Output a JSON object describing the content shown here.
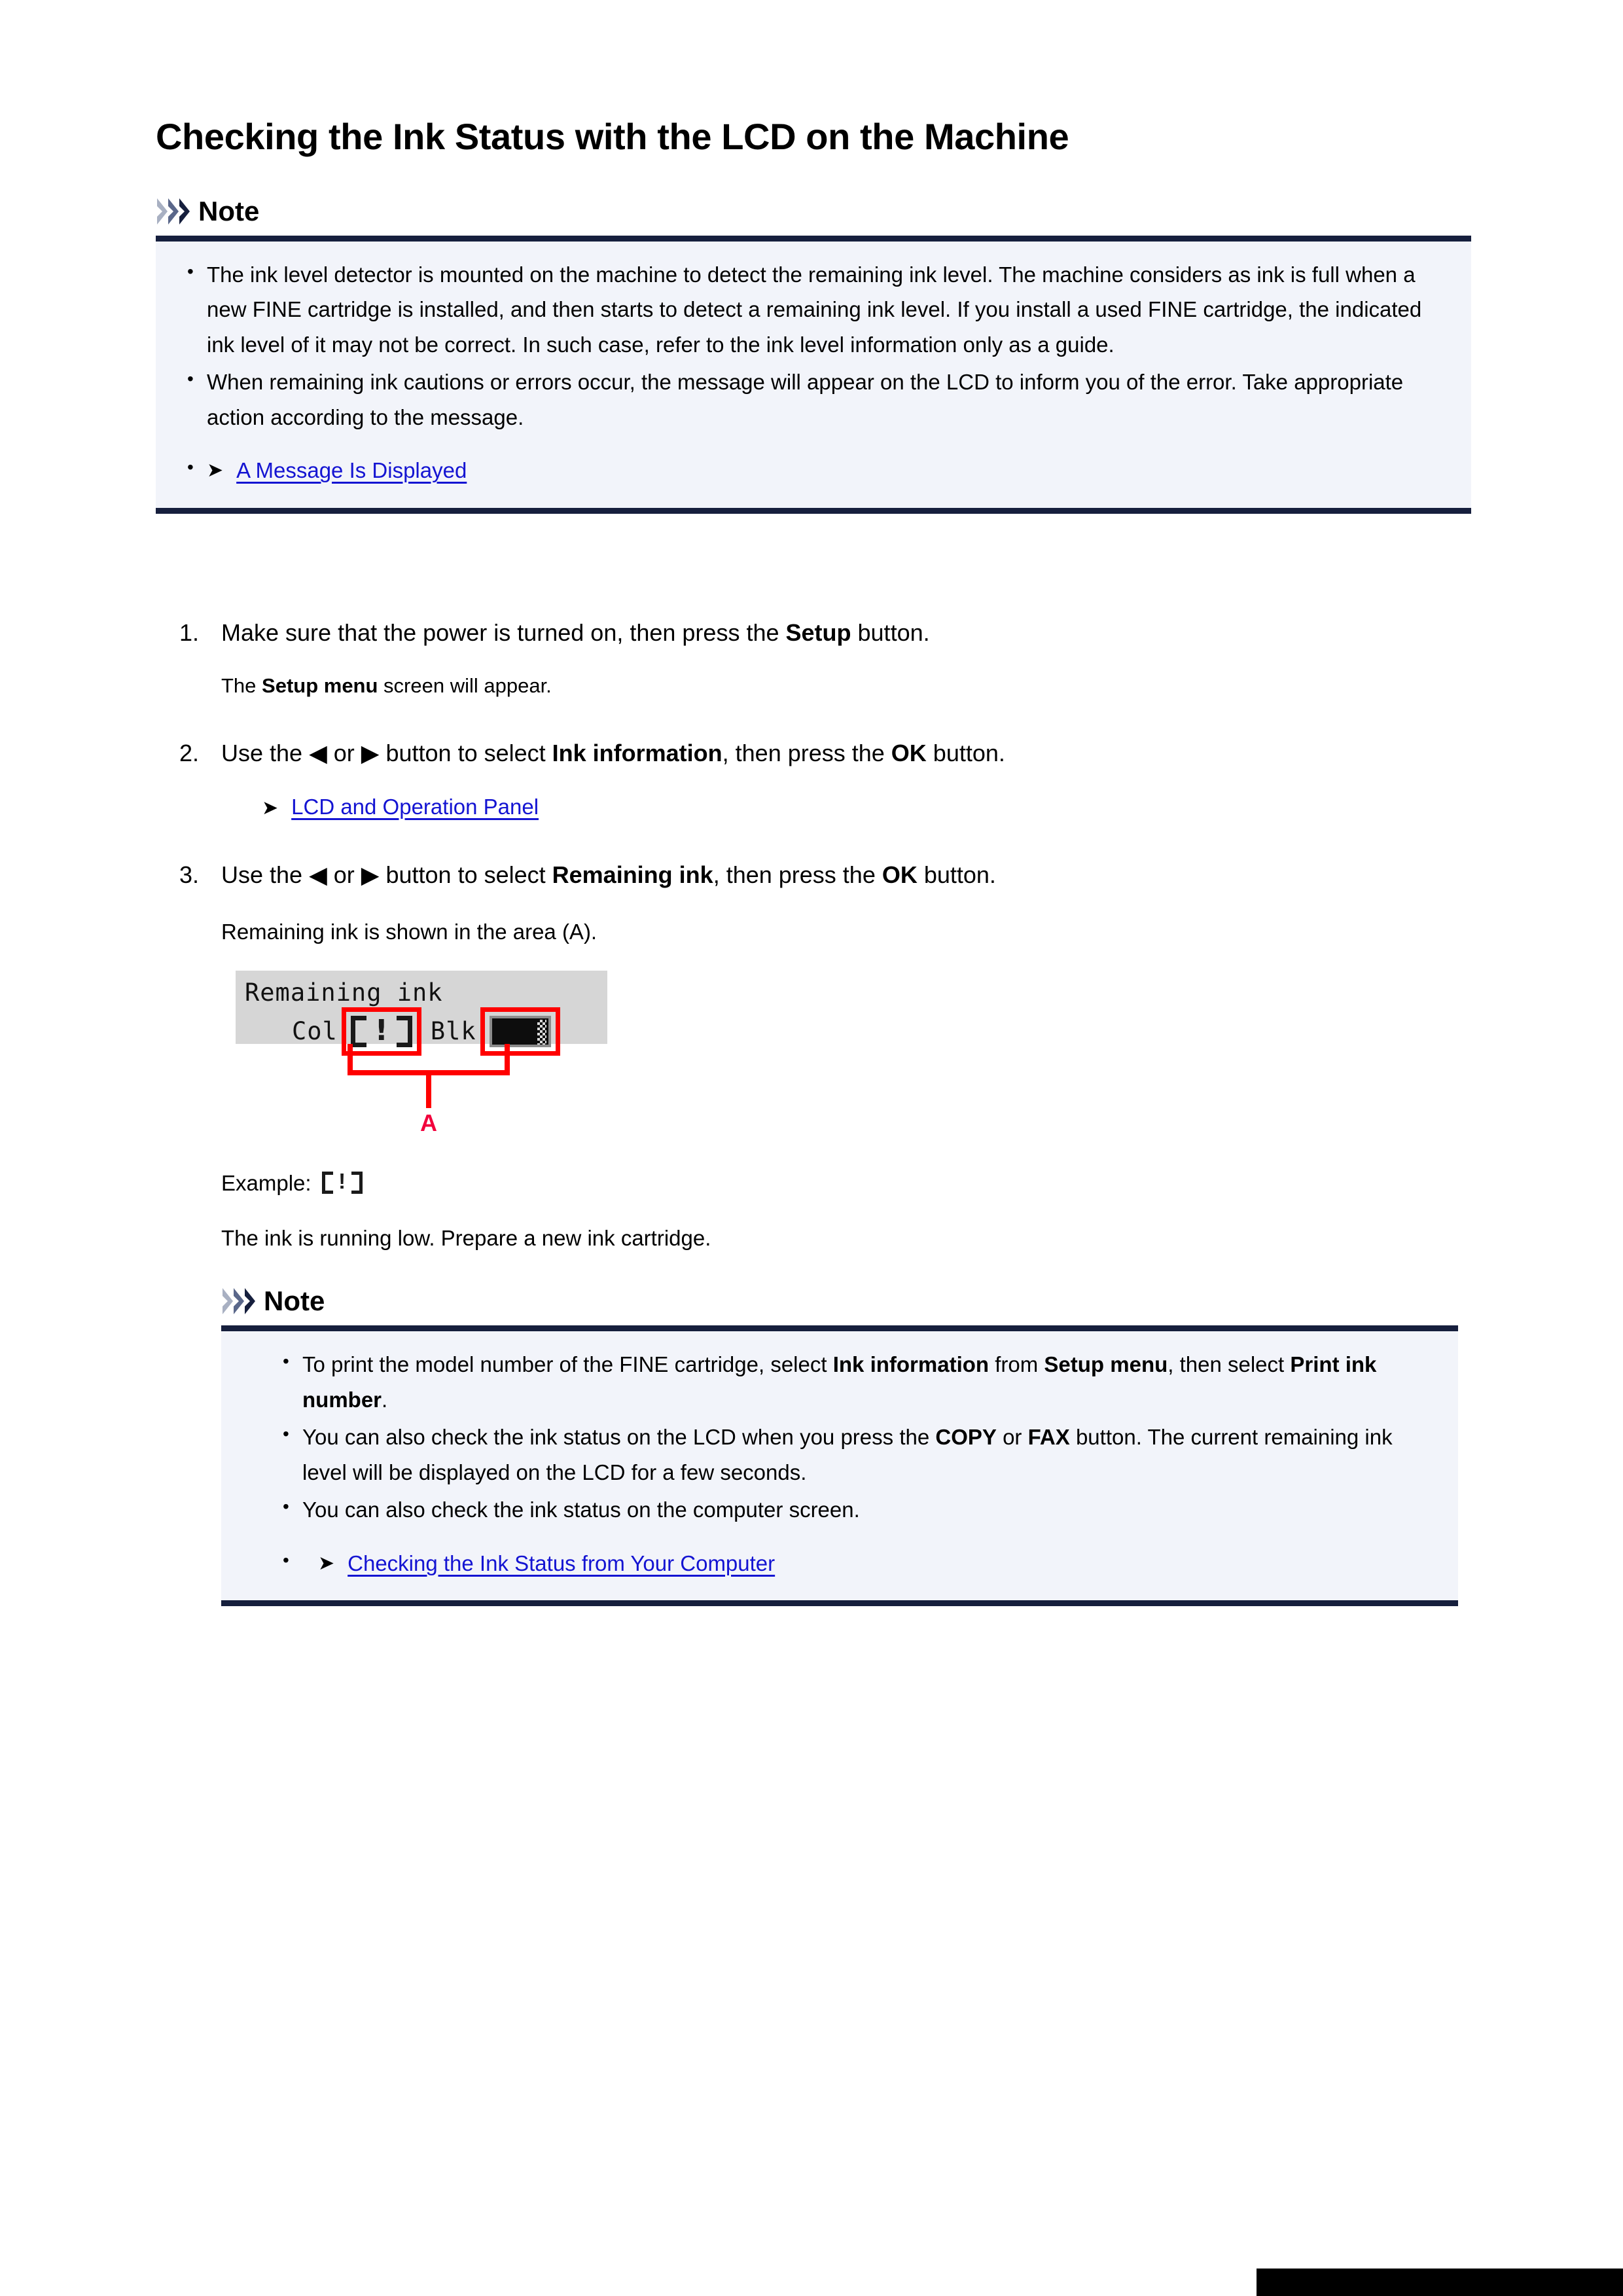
{
  "document": {
    "title": "Checking the Ink Status with the LCD on the Machine"
  },
  "note1": {
    "label": "Note",
    "bullets": [
      {
        "segments": [
          {
            "text": "The ink level detector is mounted on the machine to detect the remaining ink level. The machine considers as ink is full when a new FINE cartridge is installed, and then starts to detect a remaining ink level. If you install a used FINE cartridge, the indicated ink level of it may not be correct. In such case, refer to the ink level information only as a guide.",
            "bold": false
          }
        ]
      },
      {
        "segments": [
          {
            "text": "When remaining ink cautions or errors occur, the message will appear on the LCD to inform you of the error. Take appropriate action according to the message.",
            "bold": false
          }
        ]
      }
    ],
    "link": {
      "arrow": "arrow-right-icon",
      "text": "A Message Is Displayed"
    }
  },
  "steps": [
    {
      "number": "1.",
      "segments": [
        {
          "text": "Make sure that the power is turned on, then press the ",
          "bold": false
        },
        {
          "text": "Setup",
          "bold": true
        },
        {
          "text": " button.",
          "bold": false
        }
      ],
      "sub_segments": [
        {
          "text": "The ",
          "bold": false
        },
        {
          "text": "Setup menu",
          "bold": true
        },
        {
          "text": " screen will appear.",
          "bold": false
        }
      ]
    },
    {
      "number": "2.",
      "segments": [
        {
          "text": "Use the ",
          "bold": false
        },
        {
          "text": "◀",
          "bold": false
        },
        {
          "text": " or ",
          "bold": false
        },
        {
          "text": "▶",
          "bold": false
        },
        {
          "text": " button to select ",
          "bold": false
        },
        {
          "text": "Ink information",
          "bold": true
        },
        {
          "text": ", then press the ",
          "bold": false
        },
        {
          "text": "OK",
          "bold": true
        },
        {
          "text": " button.",
          "bold": false
        }
      ],
      "link": {
        "arrow": "arrow-right-icon",
        "text": "LCD and Operation Panel"
      }
    },
    {
      "number": "3.",
      "segments": [
        {
          "text": "Use the ",
          "bold": false
        },
        {
          "text": "◀",
          "bold": false
        },
        {
          "text": " or ",
          "bold": false
        },
        {
          "text": "▶",
          "bold": false
        },
        {
          "text": " button to select ",
          "bold": false
        },
        {
          "text": "Remaining ink",
          "bold": true
        },
        {
          "text": ", then press the ",
          "bold": false
        },
        {
          "text": "OK",
          "bold": true
        },
        {
          "text": " button.",
          "bold": false
        }
      ],
      "caption": "Remaining ink is shown in the area (A)."
    }
  ],
  "lcd": {
    "heading": "Remaining ink",
    "color_label": "Col",
    "black_label": "Blk",
    "color_status": "low-ink-alert",
    "black_status": "nearly-full-bar",
    "callout_label": "A",
    "callout_color": "#ff0000"
  },
  "example": {
    "label": "Example:",
    "glyph": "low-ink-alert",
    "description": "The ink is running low. Prepare a new ink cartridge."
  },
  "note2": {
    "label": "Note",
    "bullets": [
      {
        "segments": [
          {
            "text": "To print the model number of the FINE cartridge, select ",
            "bold": false
          },
          {
            "text": "Ink information",
            "bold": true
          },
          {
            "text": " from ",
            "bold": false
          },
          {
            "text": "Setup menu",
            "bold": true
          },
          {
            "text": ", then select ",
            "bold": false
          },
          {
            "text": "Print ink number",
            "bold": true
          },
          {
            "text": ".",
            "bold": false
          }
        ]
      },
      {
        "segments": [
          {
            "text": "You can also check the ink status on the LCD when you press the ",
            "bold": false
          },
          {
            "text": "COPY",
            "bold": true
          },
          {
            "text": " or ",
            "bold": false
          },
          {
            "text": "FAX",
            "bold": true
          },
          {
            "text": " button. The current remaining ink level will be displayed on the LCD for a few seconds.",
            "bold": false
          }
        ]
      },
      {
        "segments": [
          {
            "text": "You can also check the ink status on the computer screen.",
            "bold": false
          }
        ]
      }
    ],
    "link": {
      "arrow": "arrow-right-icon",
      "text": "Checking the Ink Status from Your Computer"
    }
  },
  "theme": {
    "note_rule": "#161f3d",
    "note_bg": "#f2f4fa",
    "link_color": "#1414d2",
    "callout_red": "#ff0000",
    "lcd_bg": "#d6d6d6",
    "chevron_light": "#a8b0c2",
    "chevron_mid": "#5a678a",
    "chevron_dark": "#161f3d"
  }
}
